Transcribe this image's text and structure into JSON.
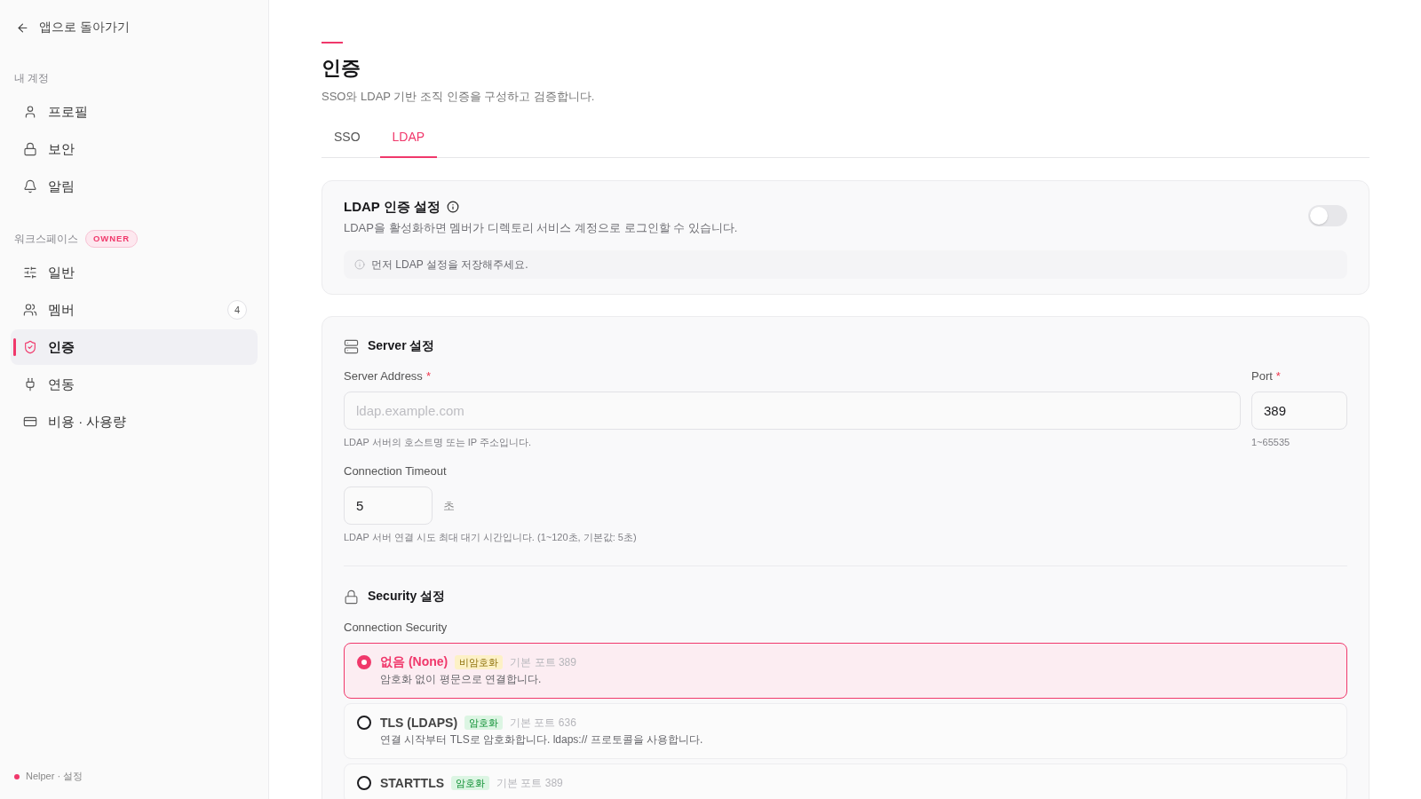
{
  "sidebar": {
    "back_link": "앱으로 돌아가기",
    "sections": [
      {
        "title": "내 계정",
        "items": [
          {
            "label": "프로필",
            "selected": false
          },
          {
            "label": "보안",
            "selected": false
          },
          {
            "label": "알림",
            "selected": false
          }
        ]
      },
      {
        "title": "워크스페이스",
        "badge": "OWNER",
        "items": [
          {
            "label": "일반",
            "selected": false
          },
          {
            "label": "멤버",
            "count": "4",
            "selected": false
          },
          {
            "label": "인증",
            "selected": true
          },
          {
            "label": "연동",
            "selected": false
          },
          {
            "label": "비용 · 사용량",
            "selected": false
          }
        ]
      }
    ],
    "footer": "Nelper · 설정"
  },
  "header": {
    "title": "인증",
    "subtitle": "SSO와 LDAP 기반 조직 인증을 구성하고 검증합니다."
  },
  "tabs": [
    {
      "label": "SSO",
      "selected": false
    },
    {
      "label": "LDAP",
      "selected": true
    }
  ],
  "ldap_card": {
    "title": "LDAP 인증 설정",
    "description": "LDAP을 활성화하면 멤버가 디렉토리 서비스 계정으로 로그인할 수 있습니다.",
    "on": false,
    "notice": "먼저 LDAP 설정을 저장해주세요."
  },
  "server_section": {
    "title": "Server 설정",
    "server_address": {
      "label": "Server Address",
      "required_mark": "*",
      "placeholder": "ldap.example.com",
      "help": "LDAP 서버의 호스트명 또는 IP 주소입니다."
    },
    "port": {
      "label": "Port",
      "required_mark": "*",
      "value": "389",
      "help": "1~65535"
    },
    "connection_timeout": {
      "label": "Connection Timeout",
      "value": "5",
      "unit": "초",
      "help": "LDAP 서버 연결 시도 최대 대기 시간입니다. (1~120초, 기본값: 5초)"
    }
  },
  "security_section": {
    "title": "Security 설정",
    "label": "Connection Security",
    "options": [
      {
        "label": "없음 (None)",
        "badge": "비암호화",
        "color": "#fdf1c6",
        "default_port": "기본 포트 389",
        "description": "암호화 없이 평문으로 연결합니다.",
        "selected": true
      },
      {
        "label": "TLS (LDAPS)",
        "badge": "암호화",
        "color": "#dcf5e3",
        "default_port": "기본 포트 636",
        "description": "연결 시작부터 TLS로 암호화합니다. ldaps:// 프로토콜을 사용합니다.",
        "selected": false
      },
      {
        "label": "STARTTLS",
        "badge": "암호화",
        "color": "#dcf5e3",
        "default_port": "기본 포트 389",
        "selected": false
      }
    ]
  }
}
